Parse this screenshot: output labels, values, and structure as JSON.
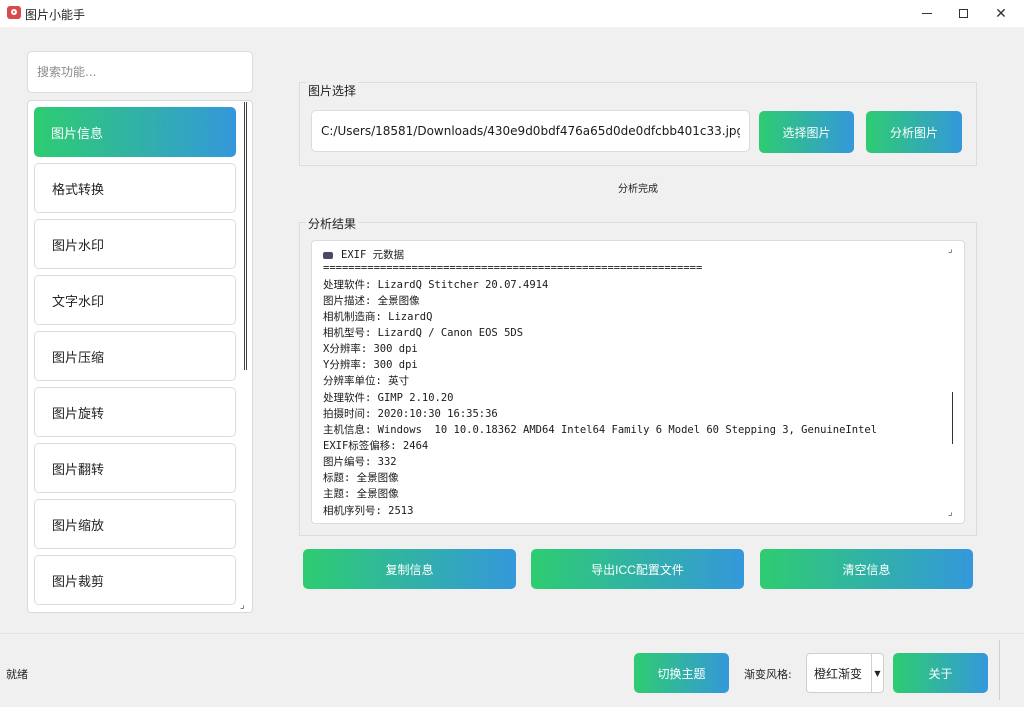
{
  "window": {
    "title": "图片小能手",
    "minimize_glyph": "—",
    "maximize_glyph": "☐",
    "close_glyph": "✕"
  },
  "sidebar": {
    "search_placeholder": "搜索功能...",
    "items": [
      {
        "label": "图片信息",
        "active": true
      },
      {
        "label": "格式转换",
        "active": false
      },
      {
        "label": "图片水印",
        "active": false
      },
      {
        "label": "文字水印",
        "active": false
      },
      {
        "label": "图片压缩",
        "active": false
      },
      {
        "label": "图片旋转",
        "active": false
      },
      {
        "label": "图片翻转",
        "active": false
      },
      {
        "label": "图片缩放",
        "active": false
      },
      {
        "label": "图片裁剪",
        "active": false
      }
    ]
  },
  "image_select": {
    "group_title": "图片选择",
    "path_value": "C:/Users/18581/Downloads/430e9d0bdf476a65d0de0dfcbb401c33.jpg",
    "select_button": "选择图片",
    "analyze_button": "分析图片",
    "status": "分析完成"
  },
  "results": {
    "group_title": "分析结果",
    "header": "EXIF 元数据",
    "separator": "============================================================",
    "lines": [
      "处理软件: LizardQ Stitcher 20.07.4914",
      "图片描述: 全景图像",
      "相机制造商: LizardQ",
      "相机型号: LizardQ / Canon EOS 5DS",
      "X分辨率: 300 dpi",
      "Y分辨率: 300 dpi",
      "分辨率单位: 英寸",
      "处理软件: GIMP 2.10.20",
      "拍摄时间: 2020:10:30 16:35:36",
      "主机信息: Windows  10 10.0.18362 AMD64 Intel64 Family 6 Model 60 Stepping 3, GenuineIntel",
      "EXIF标签偏移: 2464",
      "图片编号: 332",
      "标题: 全景图像",
      "主题: 全景图像",
      "相机序列号: 2513"
    ]
  },
  "actions": {
    "copy": "复制信息",
    "export_icc": "导出ICC配置文件",
    "clear": "清空信息"
  },
  "footer": {
    "status": "就绪",
    "switch_theme": "切换主题",
    "gradient_label": "渐变风格:",
    "gradient_value": "橙红渐变",
    "about": "关于"
  },
  "colors": {
    "gradient_start": "#2ecc71",
    "gradient_end": "#3498db"
  },
  "icons": {
    "app": "camera-icon",
    "exif": "image-icon",
    "dropdown": "triangle-down-icon"
  }
}
